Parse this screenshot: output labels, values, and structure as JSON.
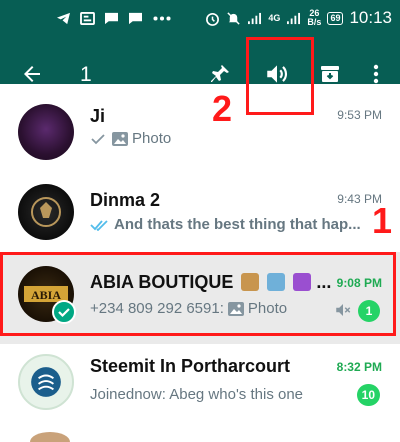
{
  "status_bar": {
    "time": "10:13",
    "net_speed_value": "26",
    "net_speed_unit": "B/s",
    "network": "4G",
    "battery": "69"
  },
  "action_bar": {
    "selected_count": "1"
  },
  "annotations": {
    "label_1": "1",
    "label_2": "2",
    "color": "#ff1a1a"
  },
  "colors": {
    "header": "#075e54",
    "accent": "#25d366",
    "check": "#00a884"
  },
  "chats": [
    {
      "name": "Ji",
      "time": "9:53 PM",
      "preview": "Photo",
      "preview_icons": [
        "single-check-icon",
        "photo-icon"
      ]
    },
    {
      "name": "Dinma 2",
      "time": "9:43 PM",
      "preview": "And thats the best thing that hap...",
      "preview_icons": [
        "double-check-icon"
      ]
    },
    {
      "name": "ABIA BOUTIQUE",
      "name_suffix": "...",
      "time": "9:08 PM",
      "preview_sender": "+234 809 292 6591:",
      "preview": "Photo",
      "unread": "1",
      "muted": true,
      "selected": true
    },
    {
      "name": "Steemit In Portharcourt",
      "time": "8:32 PM",
      "preview": "Joinednow: Abeg who's this one",
      "unread": "10"
    }
  ]
}
